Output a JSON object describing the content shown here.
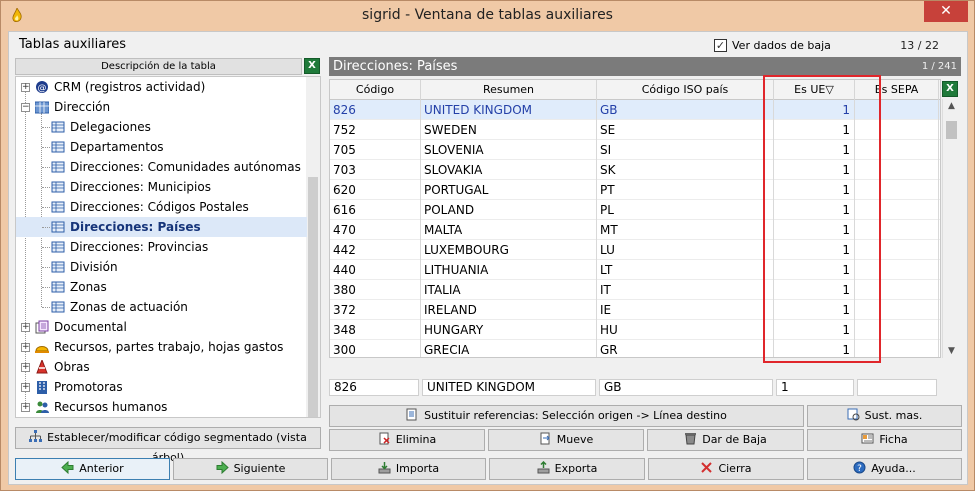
{
  "window": {
    "title": "sigrid - Ventana de tablas auxiliares",
    "close_symbol": "✕"
  },
  "header": {
    "section_title": "Tablas auxiliares",
    "checkbox_label": "Ver dados de baja",
    "checkbox_checked": true,
    "page_count": "13 / 22"
  },
  "left_panel": {
    "column_header": "Descripción de la tabla",
    "tree": [
      {
        "label": "CRM (registros actividad)",
        "level": 0,
        "expander": "+",
        "icon": "crm-icon"
      },
      {
        "label": "Dirección",
        "level": 0,
        "expander": "−",
        "icon": "folder-table-icon"
      },
      {
        "label": "Delegaciones",
        "level": 1,
        "icon": "table-icon"
      },
      {
        "label": "Departamentos",
        "level": 1,
        "icon": "table-icon"
      },
      {
        "label": "Direcciones: Comunidades autónomas",
        "level": 1,
        "icon": "table-icon"
      },
      {
        "label": "Direcciones: Municipios",
        "level": 1,
        "icon": "table-icon"
      },
      {
        "label": "Direcciones: Códigos Postales",
        "level": 1,
        "icon": "table-icon"
      },
      {
        "label": "Direcciones: Países",
        "level": 1,
        "icon": "table-icon",
        "selected": true
      },
      {
        "label": "Direcciones: Provincias",
        "level": 1,
        "icon": "table-icon"
      },
      {
        "label": "División",
        "level": 1,
        "icon": "table-icon"
      },
      {
        "label": "Zonas",
        "level": 1,
        "icon": "table-icon"
      },
      {
        "label": "Zonas de actuación",
        "level": 1,
        "icon": "table-icon"
      },
      {
        "label": "Documental",
        "level": 0,
        "expander": "+",
        "icon": "documents-icon"
      },
      {
        "label": "Recursos, partes trabajo, hojas gastos",
        "level": 0,
        "expander": "+",
        "icon": "hardhat-icon"
      },
      {
        "label": "Obras",
        "level": 0,
        "expander": "+",
        "icon": "cone-icon"
      },
      {
        "label": "Promotoras",
        "level": 0,
        "expander": "+",
        "icon": "building-icon"
      },
      {
        "label": "Recursos humanos",
        "level": 0,
        "expander": "+",
        "icon": "people-icon"
      }
    ],
    "segment_button": "Establecer/modificar código segmentado (vista árbol)"
  },
  "right_panel": {
    "title": "Direcciones: Países",
    "count": "1 / 241",
    "columns": [
      "Código",
      "Resumen",
      "Código ISO país",
      "Es UE",
      "Es SEPA"
    ],
    "sorted_column_indicator": "▽",
    "rows": [
      [
        "826",
        "UNITED KINGDOM",
        "GB",
        "1",
        ""
      ],
      [
        "752",
        "SWEDEN",
        "SE",
        "1",
        ""
      ],
      [
        "705",
        "SLOVENIA",
        "SI",
        "1",
        ""
      ],
      [
        "703",
        "SLOVAKIA",
        "SK",
        "1",
        ""
      ],
      [
        "620",
        "PORTUGAL",
        "PT",
        "1",
        ""
      ],
      [
        "616",
        "POLAND",
        "PL",
        "1",
        ""
      ],
      [
        "470",
        "MALTA",
        "MT",
        "1",
        ""
      ],
      [
        "442",
        "LUXEMBOURG",
        "LU",
        "1",
        ""
      ],
      [
        "440",
        "LITHUANIA",
        "LT",
        "1",
        ""
      ],
      [
        "380",
        "ITALIA",
        "IT",
        "1",
        ""
      ],
      [
        "372",
        "IRELAND",
        "IE",
        "1",
        ""
      ],
      [
        "348",
        "HUNGARY",
        "HU",
        "1",
        ""
      ],
      [
        "300",
        "GRECIA",
        "GR",
        "1",
        ""
      ]
    ],
    "edit_row": {
      "codigo": "826",
      "resumen": "UNITED KINGDOM",
      "iso": "GB",
      "es_ue": "1",
      "es_sepa": ""
    }
  },
  "buttons": {
    "sustituir": "Sustituir referencias: Selección origen -> Línea destino",
    "sust_mas": "Sust. mas.",
    "elimina": "Elimina",
    "mueve": "Mueve",
    "dar_baja": "Dar de Baja",
    "ficha": "Ficha",
    "anterior": "Anterior",
    "siguiente": "Siguiente",
    "importa": "Importa",
    "exporta": "Exporta",
    "cierra": "Cierra",
    "ayuda": "Ayuda..."
  },
  "colors": {
    "window_frame": "#f0c9a6",
    "close_button": "#c7413a",
    "title_bar": "#7b7b7b",
    "selection": "#dce8f8",
    "highlight_box": "#e0262b"
  }
}
